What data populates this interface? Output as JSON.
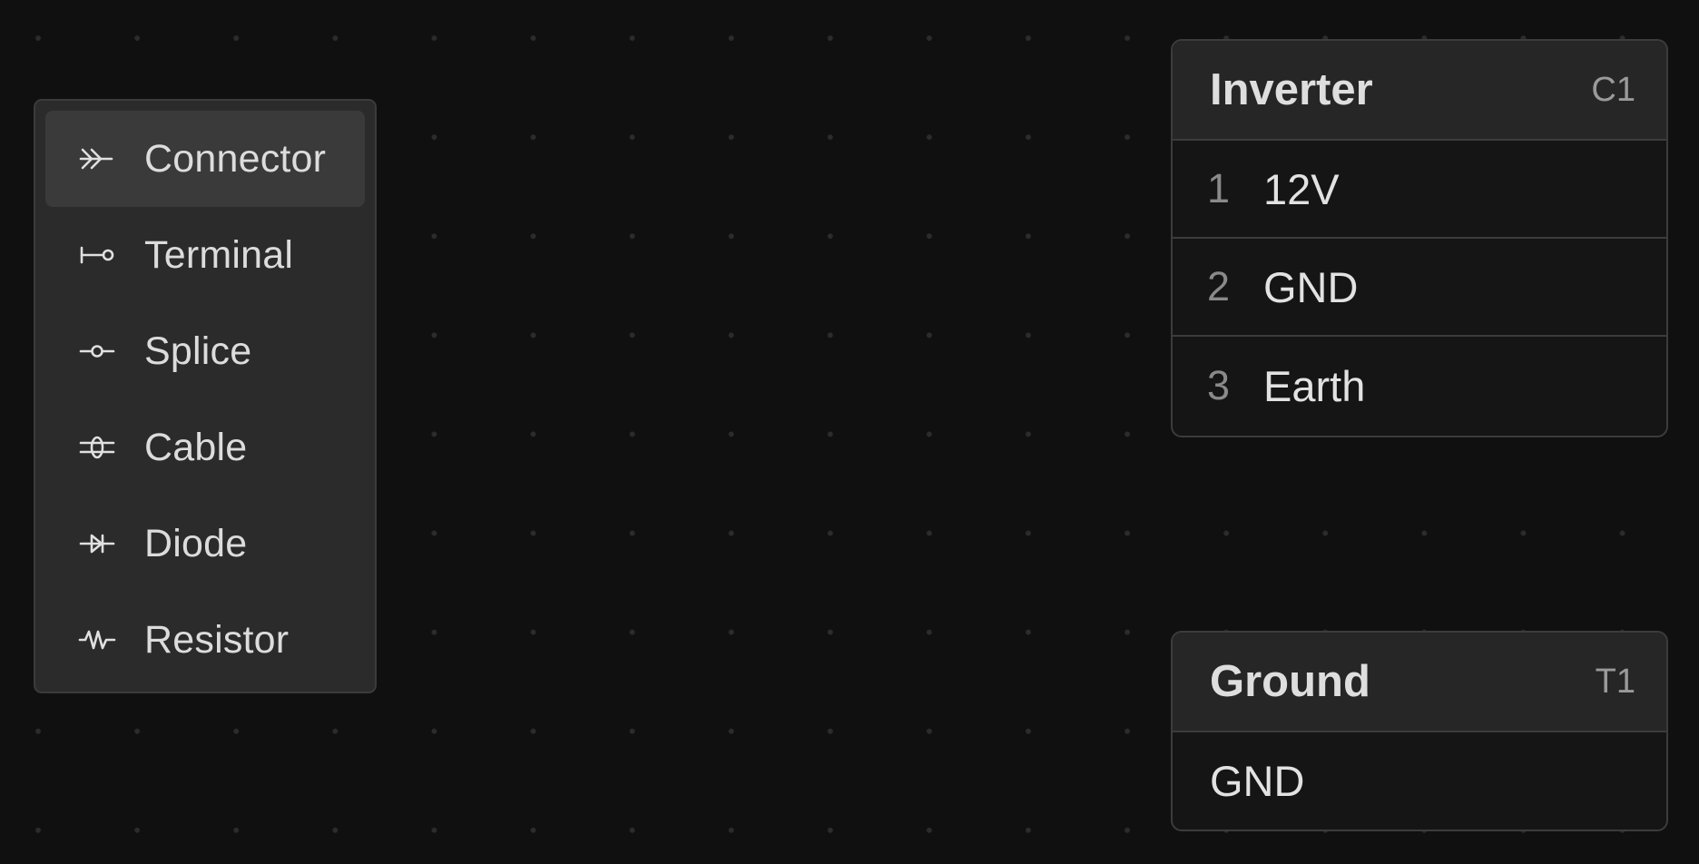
{
  "menu": {
    "items": [
      {
        "label": "Connector",
        "icon": "connector-icon",
        "active": true
      },
      {
        "label": "Terminal",
        "icon": "terminal-icon",
        "active": false
      },
      {
        "label": "Splice",
        "icon": "splice-icon",
        "active": false
      },
      {
        "label": "Cable",
        "icon": "cable-icon",
        "active": false
      },
      {
        "label": "Diode",
        "icon": "diode-icon",
        "active": false
      },
      {
        "label": "Resistor",
        "icon": "resistor-icon",
        "active": false
      }
    ]
  },
  "nodes": {
    "inverter": {
      "title": "Inverter",
      "ref": "C1",
      "pins": [
        {
          "num": "1",
          "label": "12V"
        },
        {
          "num": "2",
          "label": "GND"
        },
        {
          "num": "3",
          "label": "Earth"
        }
      ]
    },
    "ground": {
      "title": "Ground",
      "ref": "T1",
      "pin_label": "GND"
    }
  },
  "colors": {
    "canvas_bg": "#101010",
    "grid_dot": "#2c2c2c",
    "menu_bg": "#2b2b2b",
    "menu_active_bg": "#3a3a3a",
    "node_bg": "#151515",
    "node_header_bg": "#262626",
    "border": "#3c3c3c"
  }
}
